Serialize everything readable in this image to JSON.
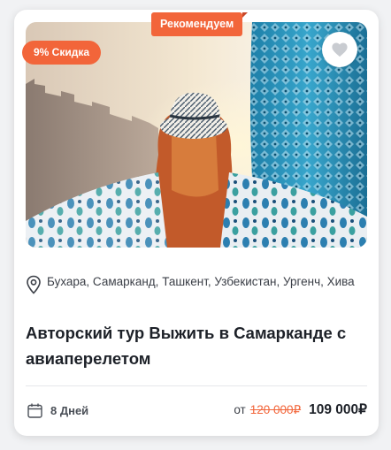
{
  "badges": {
    "recommended": "Рекомендуем",
    "discount": "9% Скидка"
  },
  "tour": {
    "locations": "Бухара, Самарканд, Ташкент, Узбекистан, Ургенч, Хива",
    "title": "Авторский тур Выжить в Самарканде с авиаперелетом",
    "duration": "8 Дней"
  },
  "price": {
    "from_label": "от",
    "old": "120 000₽",
    "new": "109 000₽"
  },
  "icons": {
    "favorite": "heart-icon",
    "location": "location-pin-icon",
    "duration": "calendar-icon"
  },
  "colors": {
    "accent": "#f2653a",
    "text": "#1d2128",
    "muted": "#3b3f47"
  }
}
